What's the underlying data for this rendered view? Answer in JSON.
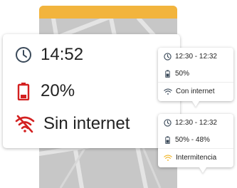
{
  "colors": {
    "header_yellow": "#f2b43d",
    "map_gray": "#c7c7c7",
    "icon_dark": "#3b4a5a",
    "alert_red": "#d32020",
    "warning_yellow": "#f0b323"
  },
  "main_card": {
    "time": "14:52",
    "battery": "20%",
    "network": "Sin internet"
  },
  "card_1": {
    "time_range": "12:30 - 12:32",
    "battery": "50%",
    "network": "Con internet"
  },
  "card_2": {
    "time_range": "12:30 - 12:32",
    "battery": "50% - 48%",
    "network": "Intermitencia"
  }
}
